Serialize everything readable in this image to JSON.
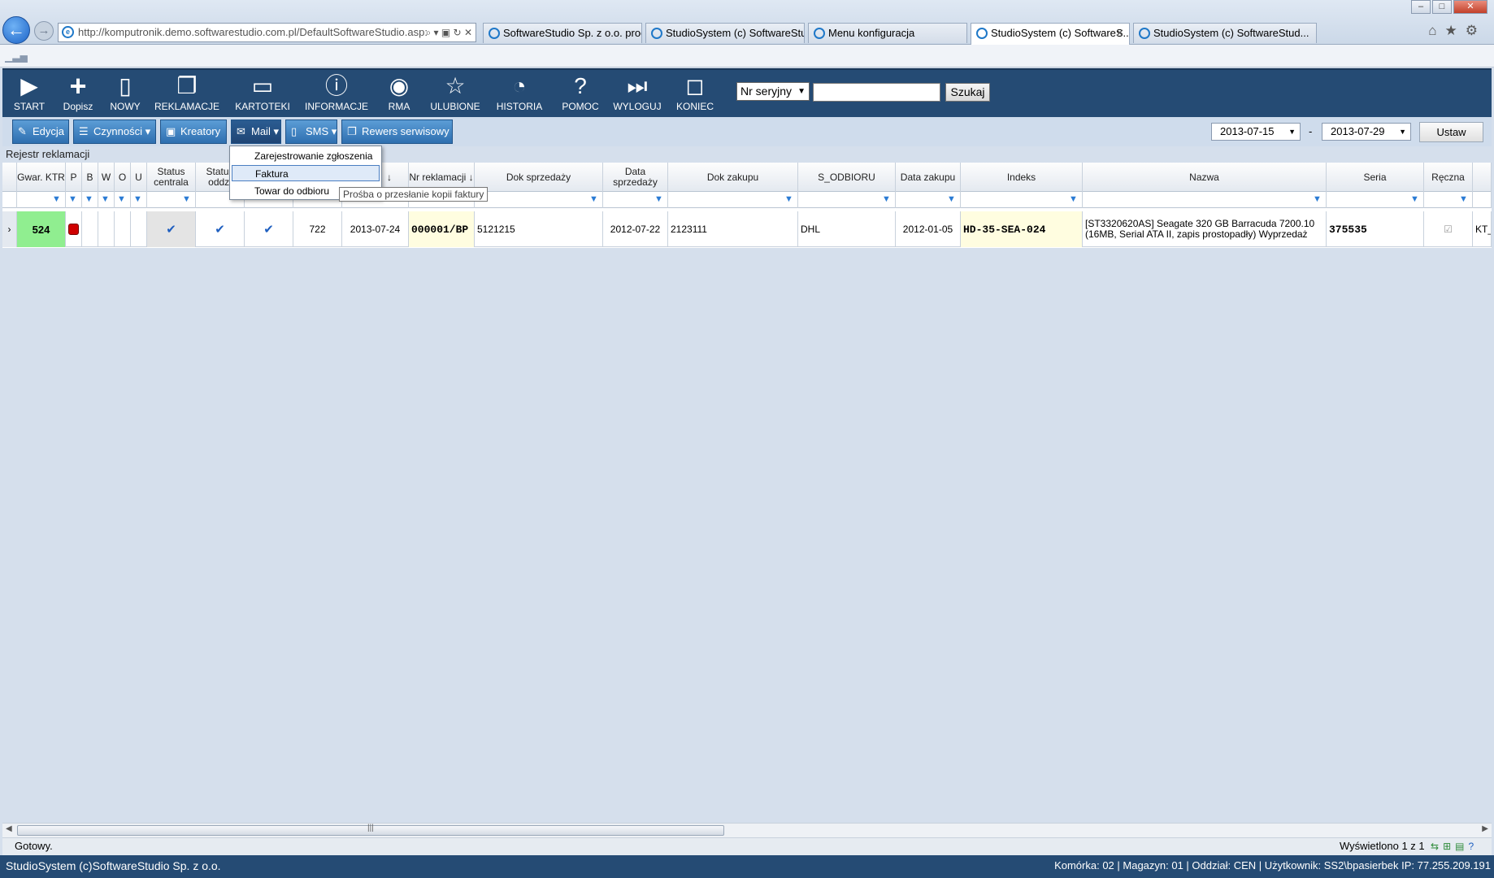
{
  "browser": {
    "address": "http://komputronik.demo.softwarestudio.com.pl/DefaultSoftwareStudio.asp:",
    "tabs": [
      {
        "label": "SoftwareStudio Sp. z o.o. prod..."
      },
      {
        "label": "StudioSystem (c) SoftwareStud..."
      },
      {
        "label": "Menu konfiguracja"
      },
      {
        "label": "StudioSystem (c) SoftwareS...",
        "active": true
      },
      {
        "label": "StudioSystem (c) SoftwareStud..."
      }
    ]
  },
  "toolbar": {
    "buttons": [
      {
        "label": "START",
        "icon": "play-icon"
      },
      {
        "label": "Dopisz",
        "icon": "plus-icon"
      },
      {
        "label": "NOWY",
        "icon": "document-icon"
      },
      {
        "label": "REKLAMACJE",
        "icon": "documents-icon"
      },
      {
        "label": "KARTOTEKI",
        "icon": "monitor-icon"
      },
      {
        "label": "INFORMACJE",
        "icon": "info-icon"
      },
      {
        "label": "RMA",
        "icon": "rma-icon"
      },
      {
        "label": "ULUBIONE",
        "icon": "star-icon"
      },
      {
        "label": "HISTORIA",
        "icon": "history-icon"
      },
      {
        "label": "POMOC",
        "icon": "help-icon"
      },
      {
        "label": "WYLOGUJ",
        "icon": "logout-icon"
      },
      {
        "label": "KONIEC",
        "icon": "exit-icon"
      }
    ],
    "search_field": "Nr seryjny",
    "search_value": "",
    "search_button": "Szukaj"
  },
  "subtoolbar": {
    "buttons": [
      {
        "label": "Edycja"
      },
      {
        "label": "Czynności"
      },
      {
        "label": "Kreatory"
      },
      {
        "label": "Mail"
      },
      {
        "label": "SMS"
      },
      {
        "label": "Rewers serwisowy"
      }
    ],
    "date_from": "2013-07-15",
    "date_sep": "-",
    "date_to": "2013-07-29",
    "set_button": "Ustaw"
  },
  "section_title": "Rejestr reklamacji",
  "grid": {
    "columns": [
      "Gwar. KTR",
      "P",
      "B",
      "W",
      "O",
      "U",
      "Status centrala",
      "Status oddzi",
      "",
      "",
      "Nr reklamacji ↓",
      "Dok sprzedaży",
      "Data sprzedaży",
      "Dok zakupu",
      "S_ODBIORU",
      "Data zakupu",
      "Indeks",
      "Nazwa",
      "Seria",
      "Ręczna",
      ""
    ],
    "date_col_arrow": "↓",
    "row": {
      "gwar": "524",
      "num": "722",
      "date": "2013-07-24",
      "nr_reklamacji": "000001/BP",
      "dok_sprzedazy": "5121215",
      "data_sprzedazy": "2012-07-22",
      "dok_zakupu": "2123111",
      "s_odbioru": "DHL",
      "data_zakupu": "2012-01-05",
      "indeks": "HD-35-SEA-024",
      "nazwa": "[ST3320620AS] Seagate 320 GB Barracuda 7200.10 (16MB, Serial ATA II, zapis prostopadły) Wyprzedaż",
      "seria": "375535",
      "reczna": "☑",
      "last": "KT_I"
    }
  },
  "mail_menu": {
    "items": [
      "Zarejestrowanie zgłoszenia",
      "Faktura",
      "Towar do odbioru"
    ],
    "tooltip": "Prośba o przesłanie kopii faktury"
  },
  "status": {
    "text": "Gotowy.",
    "shown": "Wyświetlono 1 z 1"
  },
  "footer": {
    "left": "StudioSystem (c)SoftwareStudio Sp. z o.o.",
    "right": "Komórka: 02 | Magazyn: 01 | Oddział: CEN | Użytkownik: SS2\\bpasierbek IP: 77.255.209.191"
  },
  "colors": {
    "toolbar_bg": "#254b74",
    "button_blue": "#2e6fb0",
    "gwar_green": "#90ee90",
    "status_red": "#d00000",
    "highlight_yellow": "#fffde0"
  }
}
